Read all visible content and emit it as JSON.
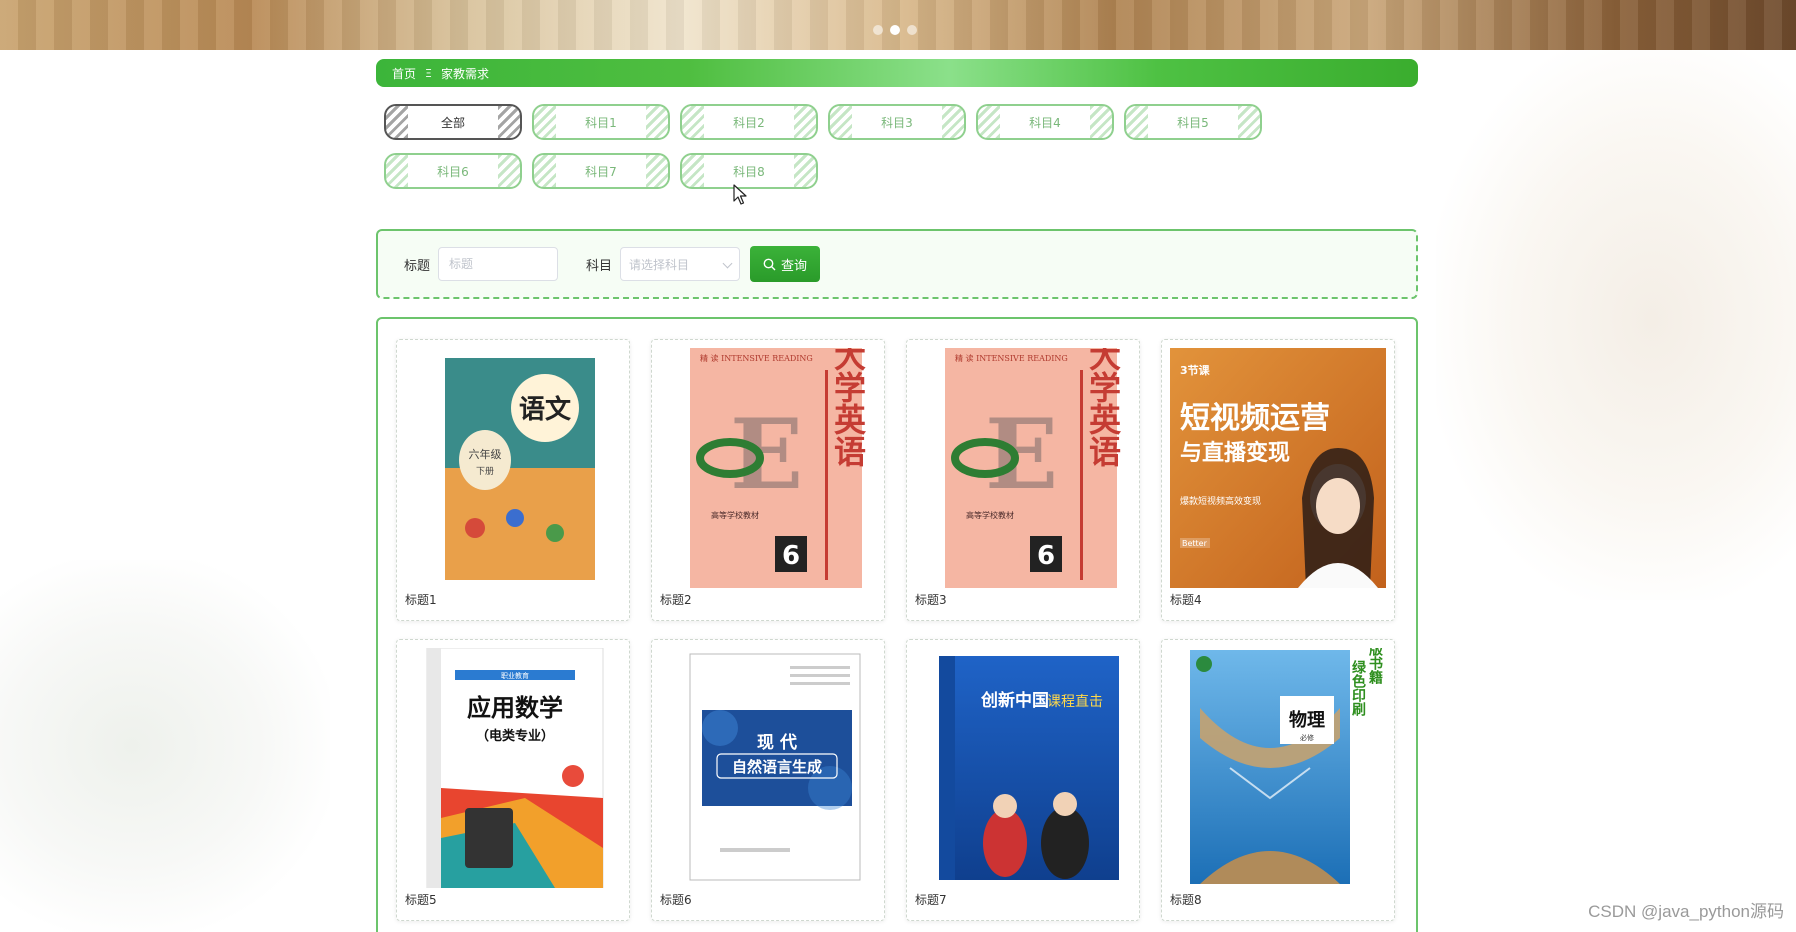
{
  "banner": {
    "dots": 3,
    "active_dot": 1
  },
  "breadcrumb": {
    "home": "首页",
    "separator": "Ξ",
    "current": "家教需求"
  },
  "categories": [
    "全部",
    "科目1",
    "科目2",
    "科目3",
    "科目4",
    "科目5",
    "科目6",
    "科目7",
    "科目8"
  ],
  "active_category": "全部",
  "search": {
    "title_label": "标题",
    "title_placeholder": "标题",
    "subject_label": "科目",
    "subject_placeholder": "请选择科目",
    "query_button": "查询"
  },
  "items": [
    {
      "title": "标题1",
      "cover": {
        "lines": [
          "语文",
          "六年级",
          "下册"
        ],
        "palette": [
          "#f08a2a",
          "#3a8c8a",
          "#f3c86b"
        ]
      }
    },
    {
      "title": "标题2",
      "cover": {
        "lines": [
          "精 读 INTENSIVE READING",
          "大学英语",
          "6",
          "高等学校教材"
        ],
        "palette": [
          "#f5b6a3",
          "#e2655b",
          "#7a6ac4"
        ]
      }
    },
    {
      "title": "标题3",
      "cover": {
        "lines": [
          "精 读 INTENSIVE READING",
          "大学英语",
          "6",
          "高等学校教材"
        ],
        "palette": [
          "#f5b6a3",
          "#e2655b",
          "#7a6ac4"
        ]
      }
    },
    {
      "title": "标题4",
      "cover": {
        "lines": [
          "3节课",
          "短视频运营",
          "与直播变现",
          "爆款短视频高效变现",
          "Better"
        ],
        "palette": [
          "#d9822b",
          "#c8691f",
          "#ffffff"
        ]
      }
    },
    {
      "title": "标题5",
      "cover": {
        "lines": [
          "应用数学",
          "（电类专业）",
          "职业教育"
        ],
        "palette": [
          "#ffffff",
          "#1b62b7",
          "#e8452f"
        ]
      }
    },
    {
      "title": "标题6",
      "cover": {
        "lines": [
          "现 代",
          "自然语言生成"
        ],
        "palette": [
          "#1d4f9a",
          "#ffffff",
          "#3d86d6"
        ]
      }
    },
    {
      "title": "标题7",
      "cover": {
        "lines": [
          "创新中国",
          "课程直击"
        ],
        "palette": [
          "#1a58b8",
          "#ffffff",
          "#c33"
        ]
      }
    },
    {
      "title": "标题8",
      "cover": {
        "lines": [
          "物理",
          "必修",
          "正版书籍",
          "绿色印刷"
        ],
        "palette": [
          "#3a9de0",
          "#c4a270",
          "#66c22e"
        ]
      }
    }
  ],
  "watermark": "CSDN @java_python源码"
}
